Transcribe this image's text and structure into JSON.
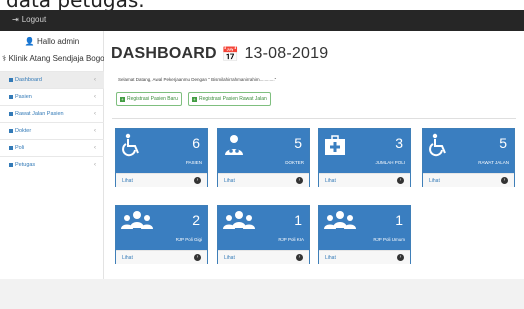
{
  "page": {
    "cut_text": "data petugas."
  },
  "topbar": {
    "logout_label": "Logout",
    "logout_icon": "sign-out-icon"
  },
  "sidebar": {
    "greeting": "Hallo admin",
    "clinic_name": "Klinik Atang Sendjaja Bogor",
    "items": [
      {
        "label": "Dashboard",
        "active": true
      },
      {
        "label": "Pasien"
      },
      {
        "label": "Rawat Jalan Pasien"
      },
      {
        "label": "Dokter"
      },
      {
        "label": "Poli"
      },
      {
        "label": "Petugas"
      }
    ]
  },
  "main": {
    "title": "DASHBOARD",
    "date": "13-08-2019",
    "welcome": "Selamat Datang, Awal Pekerjaanmu Dengan \" Bismilahirrahmanirrahim............\"",
    "buttons": [
      {
        "label": "Registrasi Pasien Baru"
      },
      {
        "label": "Registrasi Pasien Rawat Jalan"
      }
    ],
    "cards": [
      {
        "count": "6",
        "label": "PASIEN",
        "link": "Lihat",
        "icon": "wheelchair-icon"
      },
      {
        "count": "5",
        "label": "DOKTER",
        "link": "Lihat",
        "icon": "doctor-icon"
      },
      {
        "count": "3",
        "label": "JUMLAH POLI",
        "link": "Lihat",
        "icon": "medkit-icon"
      },
      {
        "count": "5",
        "label": "RAWAT JALAN",
        "link": "Lihat",
        "icon": "wheelchair-icon"
      },
      {
        "count": "2",
        "label": "RJP Poli Gigi",
        "link": "Lihat",
        "icon": "users-icon"
      },
      {
        "count": "1",
        "label": "RJP Poli KIA",
        "link": "Lihat",
        "icon": "users-icon"
      },
      {
        "count": "1",
        "label": "RJP Poli Umum",
        "link": "Lihat",
        "icon": "users-icon"
      }
    ]
  },
  "colors": {
    "card_blue": "#3a7ec0",
    "topbar": "#262626",
    "link": "#337ab7",
    "button_green": "#449d44"
  }
}
